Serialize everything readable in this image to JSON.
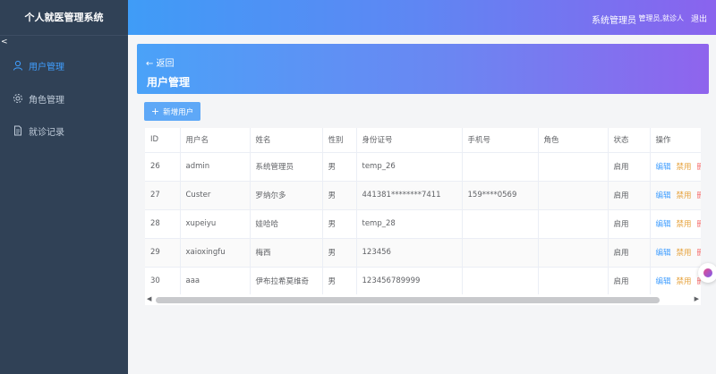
{
  "sidebar": {
    "brand": "个人就医管理系统",
    "collapse": "<",
    "items": [
      {
        "label": "用户管理",
        "icon": "user-icon",
        "active": true
      },
      {
        "label": "角色管理",
        "icon": "gear-icon",
        "active": false
      },
      {
        "label": "就诊记录",
        "icon": "document-icon",
        "active": false
      }
    ]
  },
  "topbar": {
    "user": "系统管理员",
    "roles": "管理员,就诊人",
    "logout": "退出"
  },
  "header": {
    "back": "← 返回",
    "title": "用户管理"
  },
  "toolbar": {
    "add_icon": "+",
    "add_label": "新增用户"
  },
  "table": {
    "columns": [
      "ID",
      "用户名",
      "姓名",
      "性别",
      "身份证号",
      "手机号",
      "角色",
      "状态",
      "操作"
    ],
    "rows": [
      {
        "id": "26",
        "username": "admin",
        "name": "系统管理员",
        "gender": "男",
        "idcard": "temp_26",
        "phone": "",
        "role": "",
        "status": "启用"
      },
      {
        "id": "27",
        "username": "Custer",
        "name": "罗纳尔多",
        "gender": "男",
        "idcard": "441381********7411",
        "phone": "159****0569",
        "role": "",
        "status": "启用"
      },
      {
        "id": "28",
        "username": "xupeiyu",
        "name": "娃哈哈",
        "gender": "男",
        "idcard": "temp_28",
        "phone": "",
        "role": "",
        "status": "启用"
      },
      {
        "id": "29",
        "username": "xaioxingfu",
        "name": "梅西",
        "gender": "男",
        "idcard": "123456",
        "phone": "",
        "role": "",
        "status": "启用"
      },
      {
        "id": "30",
        "username": "aaa",
        "name": "伊布拉希莫维奇",
        "gender": "男",
        "idcard": "123456789999",
        "phone": "",
        "role": "",
        "status": "启用"
      }
    ],
    "actions": {
      "edit": "编辑",
      "ban": "禁用",
      "del": "删除"
    }
  },
  "colors": {
    "sidebar_bg": "#304156",
    "accent": "#409eff",
    "warning": "#e6a23c",
    "danger": "#f56c6c"
  }
}
